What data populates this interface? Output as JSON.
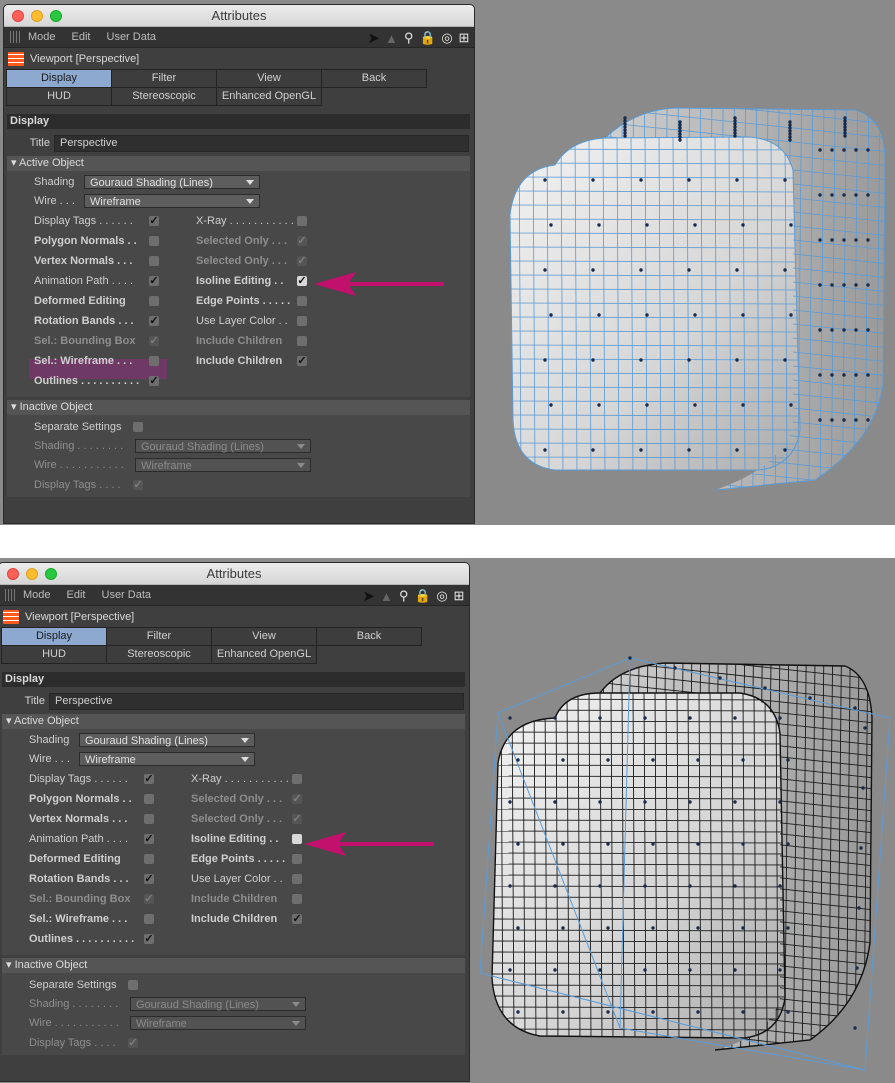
{
  "window": {
    "title": "Attributes",
    "menu": [
      "Mode",
      "Edit",
      "User Data"
    ]
  },
  "object": {
    "name": "Viewport [Perspective]"
  },
  "tabs": [
    "Display",
    "Filter",
    "View",
    "Back",
    "HUD",
    "Stereoscopic",
    "Enhanced OpenGL"
  ],
  "active_tab": "Display",
  "section": "Display",
  "title_field": {
    "label": "Title",
    "value": "Perspective"
  },
  "active_object": {
    "header": "Active Object",
    "shading": {
      "label": "Shading",
      "value": "Gouraud Shading (Lines)"
    },
    "wire": {
      "label": "Wire . . .",
      "value": "Wireframe"
    },
    "left": [
      {
        "label": "Display Tags . . . . . .",
        "checked": true
      },
      {
        "label": "Polygon Normals . .",
        "checked": false
      },
      {
        "label": "Vertex Normals . . .",
        "checked": false
      },
      {
        "label": "Animation Path . . . .",
        "checked": true
      },
      {
        "label": "Deformed Editing",
        "checked": false
      },
      {
        "label": "Rotation Bands . . .",
        "checked": true
      },
      {
        "label": "Sel.: Bounding Box",
        "checked": true
      },
      {
        "label": "Sel.: Wireframe . . .",
        "checked": false
      },
      {
        "label": "Outlines . . . . . . . . . .",
        "checked": true
      }
    ],
    "right": [
      {
        "label": "X-Ray . . . . . . . . . . .",
        "checked": false
      },
      {
        "label": "Selected Only . . .",
        "checked": true
      },
      {
        "label": "Selected Only . . .",
        "checked": true
      },
      {
        "label": "Isoline Editing . .",
        "checked": true
      },
      {
        "label": "Edge Points . . . . .",
        "checked": false
      },
      {
        "label": "Use Layer Color . .",
        "checked": false
      },
      {
        "label": "Include Children",
        "checked": false
      },
      {
        "label": "Include Children",
        "checked": true
      }
    ]
  },
  "inactive_object": {
    "header": "Inactive Object",
    "separate": {
      "label": "Separate Settings",
      "checked": false
    },
    "shading": {
      "label": "Shading . . . . . . . .",
      "value": "Gouraud Shading (Lines)"
    },
    "wire": {
      "label": "Wire . . . . . . . . . . .",
      "value": "Wireframe"
    },
    "display_tags": {
      "label": "Display Tags . . . .",
      "checked": true
    }
  },
  "states": {
    "top": {
      "isoline_editing": true,
      "sel_wireframe_highlighted": true
    },
    "bottom": {
      "isoline_editing": false,
      "sel_wireframe_highlighted": false
    }
  },
  "colors": {
    "accent_tab": "#8ea9cf",
    "annotation_arrow": "#c2106d",
    "wire_blue": "#5b9bd5",
    "highlight": "#a0288c"
  },
  "icons": [
    "back-arrow-icon",
    "up-arrow-icon",
    "search-icon",
    "lock-icon",
    "target-icon",
    "new-panel-icon",
    "viewport-icon",
    "checkmark-icon"
  ]
}
